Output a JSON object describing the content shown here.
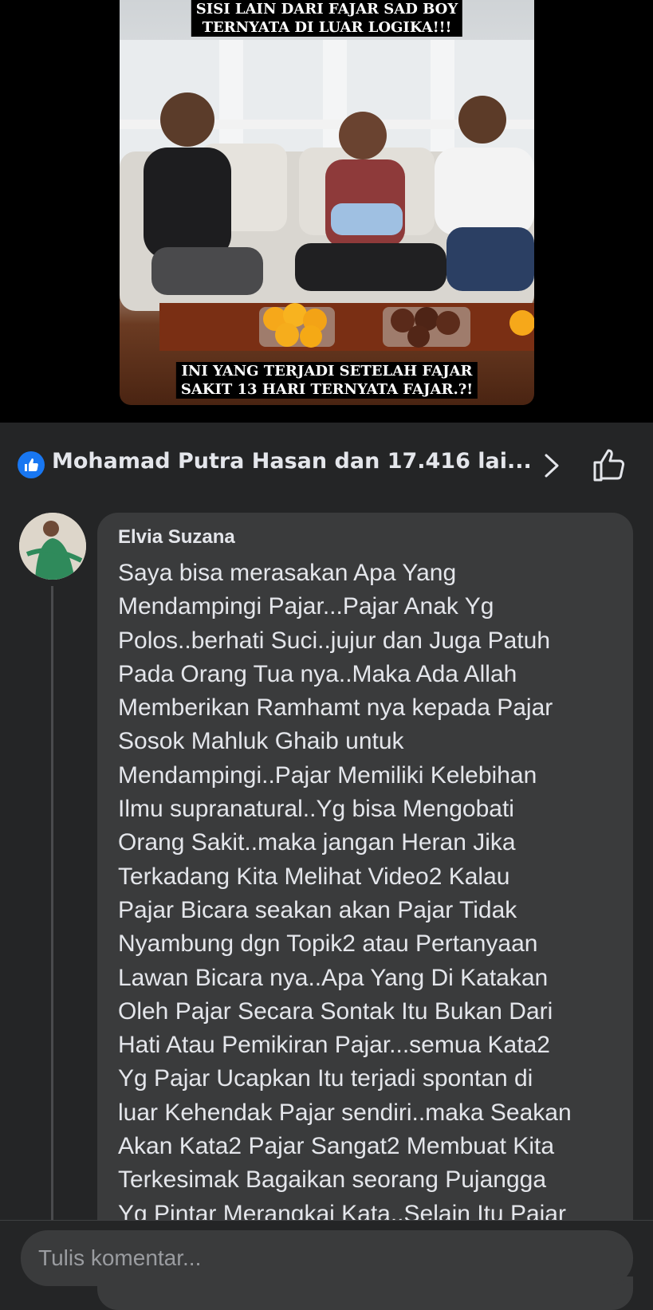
{
  "video": {
    "caption_top_line1": "SISI LAIN DARI FAJAR SAD BOY",
    "caption_top_line2": "TERNYATA DI LUAR LOGIKA!!!",
    "caption_bottom_line1": "INI YANG TERJADI SETELAH FAJAR",
    "caption_bottom_line2": "SAKIT 13 HARI TERNYATA FAJAR.?!"
  },
  "reactions": {
    "summary": "Mohamad Putra Hasan dan 17.416 lai...",
    "badge_icon": "like-icon",
    "next_icon": "chevron-right-icon",
    "action_icon": "thumbs-up-icon"
  },
  "comment": {
    "author": "Elvia Suzana",
    "text": "Saya bisa merasakan Apa Yang\nMendampingi Pajar...Pajar Anak Yg\nPolos..berhati Suci..jujur dan Juga Patuh\nPada Orang Tua nya..Maka Ada Allah\nMemberikan Ramhamt nya kepada Pajar\nSosok Mahluk Ghaib untuk\nMendampingi..Pajar Memiliki Kelebihan\nIlmu supranatural..Yg bisa Mengobati\nOrang Sakit..maka jangan Heran Jika\nTerkadang Kita Melihat Video2 Kalau\nPajar Bicara seakan akan Pajar Tidak\nNyambung dgn Topik2 atau Pertanyaan\nLawan Bicara nya..Apa Yang Di Katakan\nOleh Pajar Secara Sontak Itu Bukan Dari\nHati Atau Pemikiran Pajar...semua Kata2\nYg Pajar Ucapkan Itu terjadi spontan di\nluar Kehendak Pajar sendiri..maka Seakan\nAkan Kata2 Pajar Sangat2 Membuat Kita\nTerkesimak Bagaikan seorang Pujangga\nYg Pintar Merangkai Kata..Selain Itu Pajar"
  },
  "composer": {
    "placeholder": "Tulis komentar..."
  },
  "colors": {
    "background": "#242526",
    "bubble": "#3a3b3c",
    "accent": "#1877f2",
    "text": "#e4e6eb"
  }
}
